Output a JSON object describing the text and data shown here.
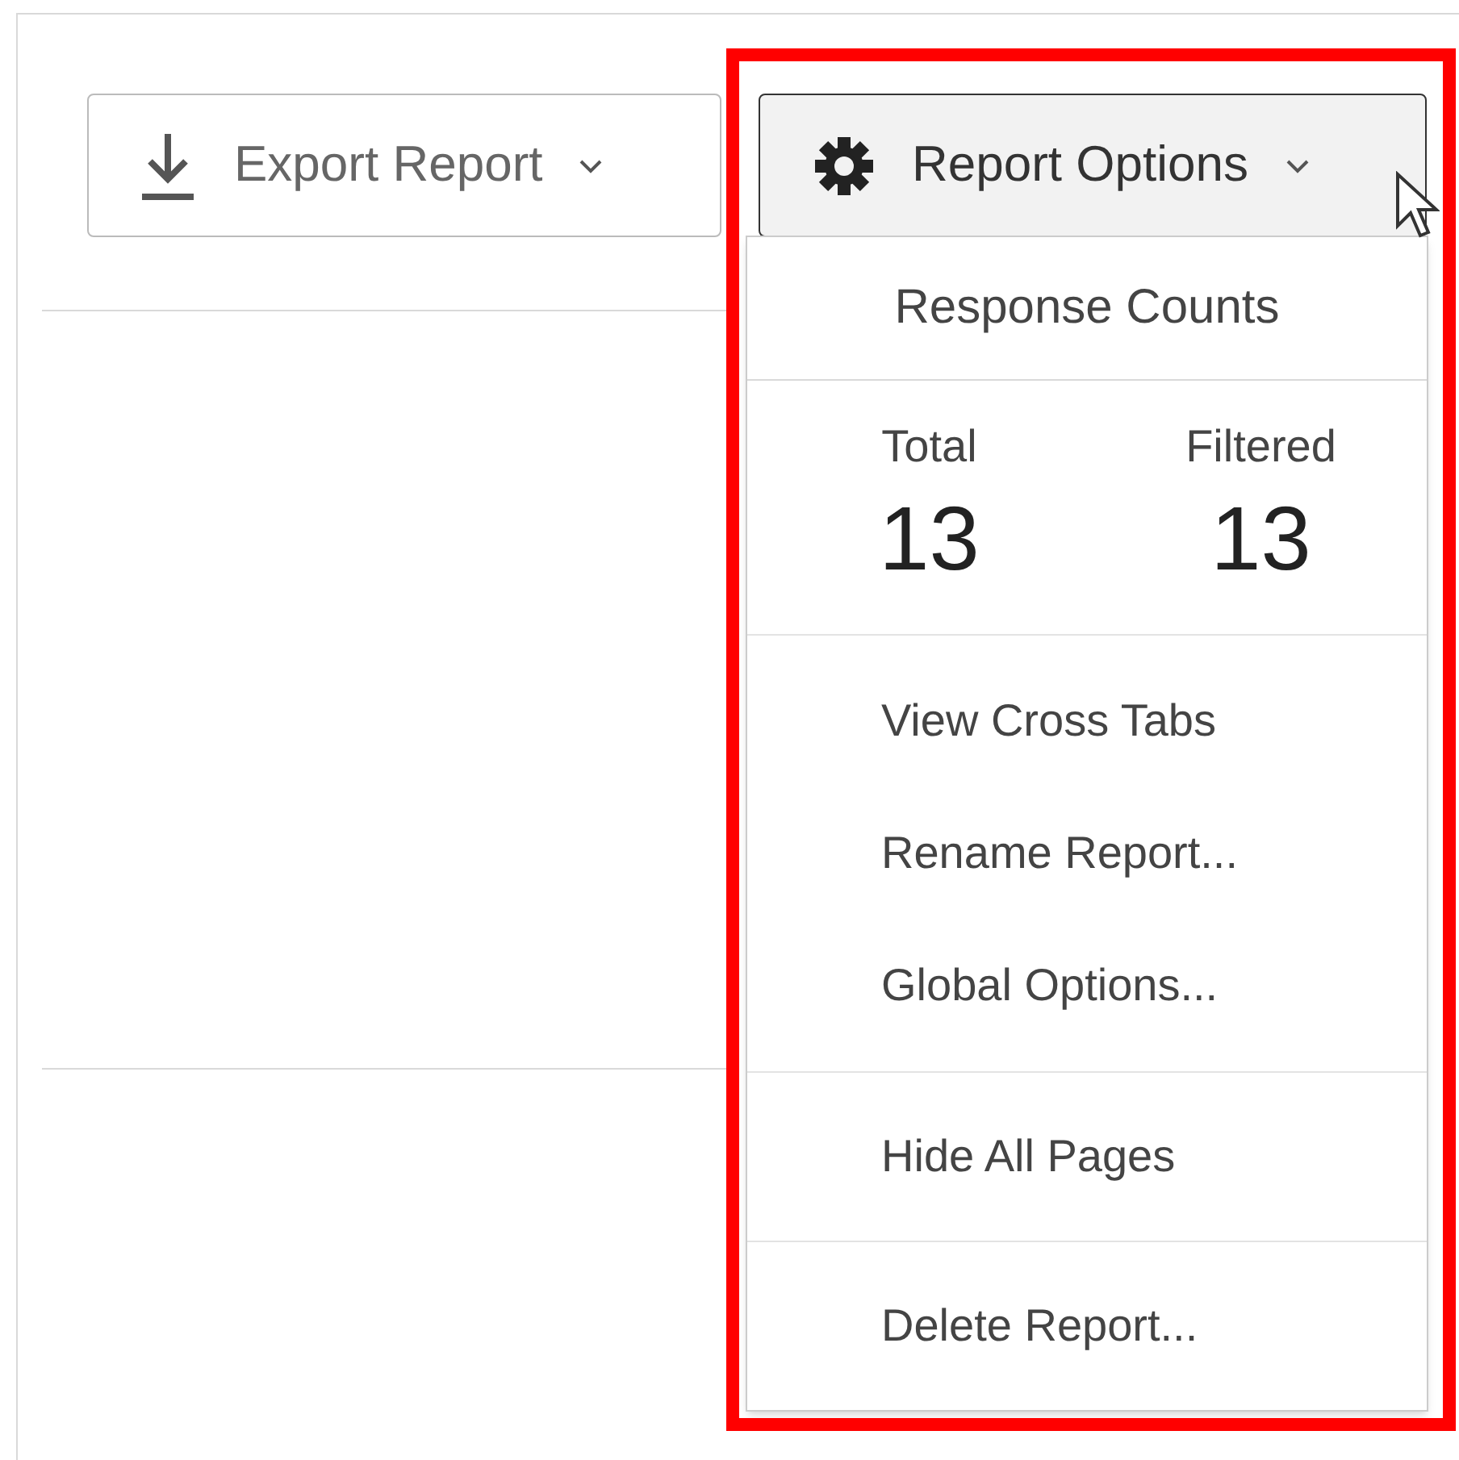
{
  "toolbar": {
    "export_button": {
      "label": "Export Report"
    },
    "options_button": {
      "label": "Report Options",
      "expanded": true
    }
  },
  "menu": {
    "header": "Response Counts",
    "counts": [
      {
        "label": "Total",
        "value": "13"
      },
      {
        "label": "Filtered",
        "value": "13"
      }
    ],
    "sections": [
      {
        "items": [
          {
            "label": "View Cross Tabs"
          },
          {
            "label": "Rename Report..."
          },
          {
            "label": "Global Options..."
          }
        ]
      },
      {
        "items": [
          {
            "label": "Hide All Pages"
          }
        ]
      },
      {
        "items": [
          {
            "label": "Delete Report..."
          }
        ]
      }
    ]
  }
}
